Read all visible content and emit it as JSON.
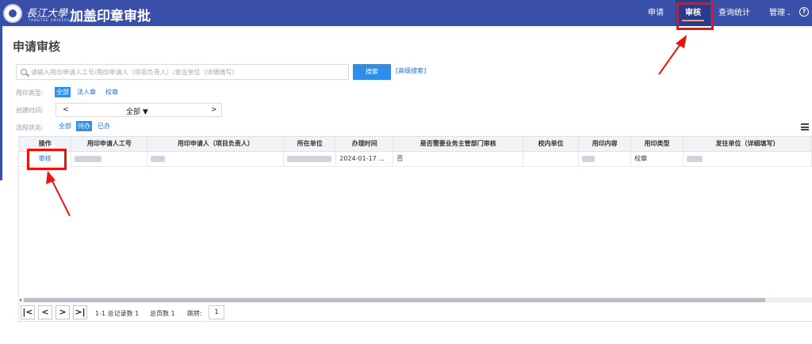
{
  "header": {
    "university_name": "長江大學",
    "university_sub": "YANGTZE UNIVERSITY",
    "app_title": "加盖印章审批",
    "nav": [
      {
        "label": "申请"
      },
      {
        "label": "审核"
      },
      {
        "label": "查询统计"
      },
      {
        "label": "管理"
      }
    ],
    "help_glyph": "?"
  },
  "page": {
    "title": "申请审核"
  },
  "search": {
    "placeholder": "请输入用印申请人工号/用印申请人（项目负责人）/发往单位（详细填写）",
    "button_label": "搜索",
    "advanced_label": "[高级搜索]"
  },
  "filters": {
    "seal_type": {
      "label": "用印类型:",
      "options": [
        "全部",
        "法人章",
        "校章"
      ],
      "selected": "全部"
    },
    "created_time": {
      "label": "创建时间:",
      "prev": "<",
      "value": "全部",
      "caret": "▼",
      "next": ">"
    },
    "flow_status": {
      "label": "流程状态:",
      "options": [
        "全部",
        "待办",
        "已办"
      ],
      "selected": "待办"
    }
  },
  "table": {
    "columns": [
      "操作",
      "用印申请人工号",
      "用印申请人（项目负责人）",
      "所在单位",
      "办理时间",
      "是否需要业务主管部门审核",
      "校内单位",
      "用印内容",
      "用印类型",
      "发往单位（详细填写）"
    ],
    "rows": [
      {
        "action": "审核",
        "applicant_id": "",
        "applicant_name": "",
        "department": "",
        "handle_time": "2024-01-17 ...",
        "need_dept_review": "否",
        "internal_unit": "",
        "seal_content": "",
        "seal_type": "校章",
        "send_to": ""
      }
    ]
  },
  "pager": {
    "first": "|<",
    "prev": "<",
    "next": ">",
    "last": ">|",
    "range_text": "1-1 总记录数 1",
    "pages_text": "总页数 1",
    "jump_label": "跳转:",
    "jump_value": "1"
  },
  "colors": {
    "header_bg": "#3a4fa8",
    "accent_blue": "#2e8fe8",
    "annotation_red": "#e8140f"
  }
}
